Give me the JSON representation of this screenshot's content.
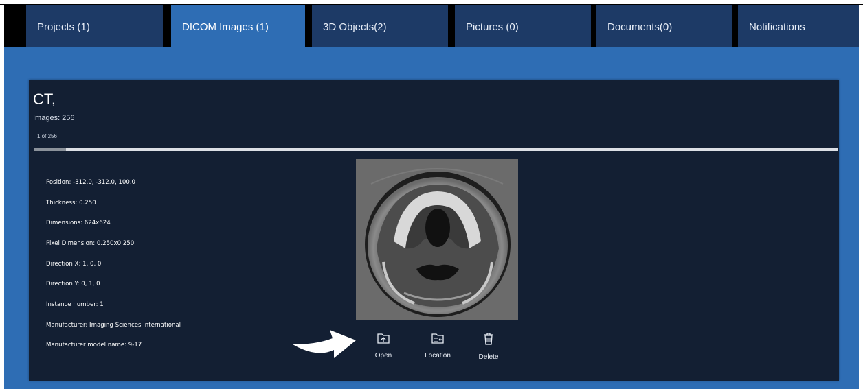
{
  "tabs": [
    {
      "label": "Projects (1)"
    },
    {
      "label": "DICOM Images (1)"
    },
    {
      "label": "3D Objects(2)"
    },
    {
      "label": "Pictures (0)"
    },
    {
      "label": "Documents(0)"
    },
    {
      "label": "Notifications"
    }
  ],
  "active_tab": "DICOM Images (1)",
  "series": {
    "title": "CT,",
    "images_label": "Images: 256",
    "slice_label": "1 of 256",
    "slice_progress": 0.039
  },
  "metadata": [
    "Position: -312.0, -312.0, 100.0",
    "Thickness: 0.250",
    "Dimensions: 624x624",
    "Pixel Dimension: 0.250x0.250",
    "Direction X: 1, 0, 0",
    "Direction Y: 0, 1, 0",
    "Instance number: 1",
    "Manufacturer: Imaging Sciences International",
    "Manufacturer model name: 9-17"
  ],
  "actions": {
    "open": {
      "label": "Open",
      "icon": "folder-upload-icon"
    },
    "location": {
      "label": "Location",
      "icon": "folder-location-icon"
    },
    "delete": {
      "label": "Delete",
      "icon": "trash-icon"
    }
  },
  "colors": {
    "background": "#2e6db4",
    "tab": "#1d3a66",
    "panel": "#131f33",
    "divider": "#4f86c7"
  }
}
